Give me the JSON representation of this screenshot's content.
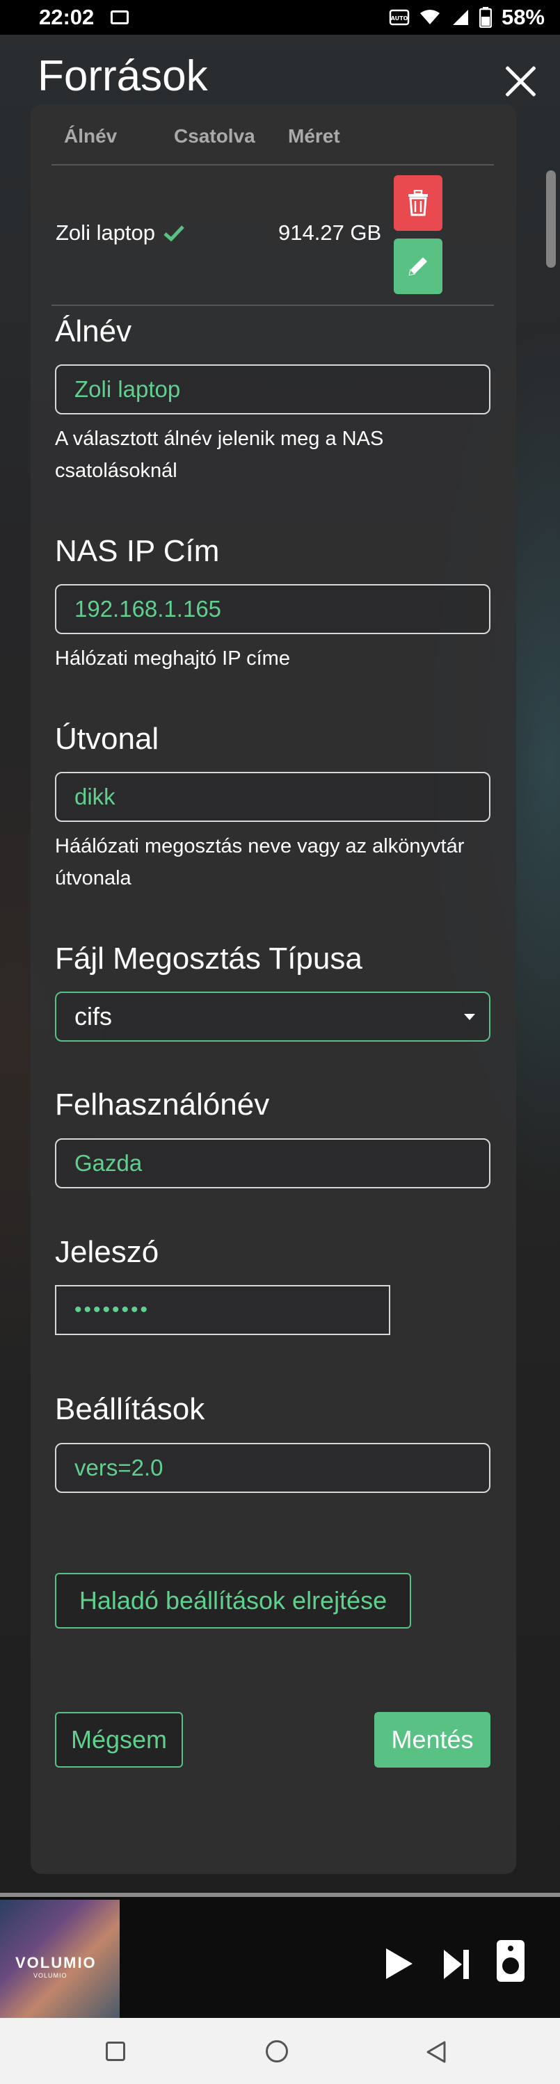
{
  "statusbar": {
    "time": "22:02",
    "battery": "58%"
  },
  "modal": {
    "title": "Források",
    "table": {
      "headers": [
        "Álnév",
        "Csatolva",
        "Méret"
      ],
      "rows": [
        {
          "alias": "Zoli laptop",
          "mounted": true,
          "size": "914.27 GB"
        }
      ]
    },
    "fields": {
      "alias": {
        "label": "Álnév",
        "value": "Zoli laptop",
        "help": "A választott álnév jelenik meg a NAS csatolásoknál"
      },
      "nas_ip": {
        "label": "NAS IP Cím",
        "value": "192.168.1.165",
        "help": "Hálózati meghajtó IP címe"
      },
      "path": {
        "label": "Útvonal",
        "value": "dikk",
        "help": "Háálózati megosztás neve vagy az alkönyvtár útvonala"
      },
      "fstype": {
        "label": "Fájl Megosztás Típusa",
        "value": "cifs"
      },
      "username": {
        "label": "Felhasználónév",
        "value": "Gazda"
      },
      "password": {
        "label": "Jeleszó",
        "value": "••••••••"
      },
      "options": {
        "label": "Beállítások",
        "value": "vers=2.0"
      }
    },
    "advanced_toggle": "Haladó beállítások elrejtése",
    "cancel_label": "Mégsem",
    "save_label": "Mentés"
  },
  "player": {
    "album_logo": "VOLUMIO",
    "album_sub": "VOLUMIO"
  },
  "colors": {
    "accent": "#59c184",
    "danger": "#e84a4f",
    "text_accent": "#5fd08e"
  }
}
